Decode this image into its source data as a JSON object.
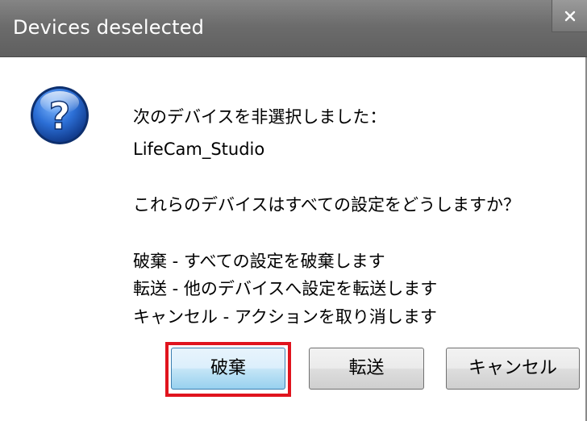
{
  "window": {
    "title": "Devices deselected",
    "close_icon": "close-icon"
  },
  "dialog": {
    "icon": "question-icon",
    "message_lines": [
      "次のデバイスを非選択しました：",
      "LifeCam_Studio",
      "これらのデバイスはすべての設定をどうしますか？",
      "破棄 - すべての設定を破棄します",
      "転送 - 他のデバイスへ設定を転送します",
      "キャンセル - アクションを取り消します"
    ]
  },
  "buttons": {
    "discard": "破棄",
    "transfer": "転送",
    "cancel": "キャンセル"
  },
  "colors": {
    "highlight": "#e0141e",
    "titlebar": "#6c6c6c"
  }
}
